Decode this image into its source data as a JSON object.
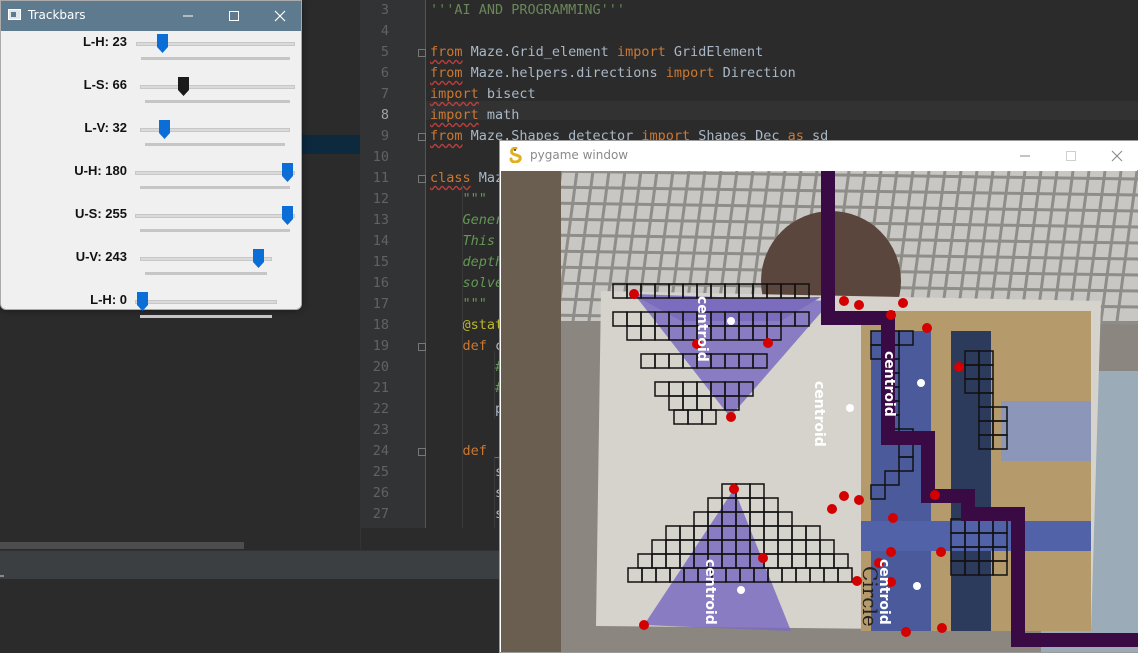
{
  "ide": {
    "lines": [
      {
        "num": "3",
        "segs": [
          {
            "t": "'''AI AND PROGRAMMING'''",
            "c": "str"
          }
        ]
      },
      {
        "num": "4",
        "segs": []
      },
      {
        "num": "5",
        "segs": [
          {
            "t": "from",
            "c": "kw squig"
          },
          {
            "t": " Maze.Grid_element ",
            "c": ""
          },
          {
            "t": "import",
            "c": "kw"
          },
          {
            "t": " GridElement",
            "c": ""
          }
        ]
      },
      {
        "num": "6",
        "segs": [
          {
            "t": "from",
            "c": "kw squig"
          },
          {
            "t": " Maze.helpers.directions ",
            "c": ""
          },
          {
            "t": "import",
            "c": "kw"
          },
          {
            "t": " Direction",
            "c": ""
          }
        ]
      },
      {
        "num": "7",
        "segs": [
          {
            "t": "import",
            "c": "kw squig"
          },
          {
            "t": " bisect",
            "c": ""
          }
        ]
      },
      {
        "num": "8",
        "segs": [
          {
            "t": "import",
            "c": "kw squig"
          },
          {
            "t": " math",
            "c": ""
          }
        ]
      },
      {
        "num": "9",
        "segs": [
          {
            "t": "from",
            "c": "kw squig"
          },
          {
            "t": " Maze.Shapes_detector ",
            "c": ""
          },
          {
            "t": "import",
            "c": "kw"
          },
          {
            "t": " Shapes_Dec ",
            "c": ""
          },
          {
            "t": "as",
            "c": "kw"
          },
          {
            "t": " sd",
            "c": ""
          }
        ]
      },
      {
        "num": "10",
        "segs": []
      },
      {
        "num": "11",
        "segs": [
          {
            "t": "class",
            "c": "kw squig"
          },
          {
            "t": " Maze",
            "c": ""
          }
        ]
      },
      {
        "num": "12",
        "segs": [
          {
            "t": "    \"\"\"",
            "c": "doc"
          }
        ]
      },
      {
        "num": "13",
        "segs": [
          {
            "t": "    Gener",
            "c": "doc"
          }
        ]
      },
      {
        "num": "14",
        "segs": [
          {
            "t": "    This",
            "c": "doc"
          }
        ]
      },
      {
        "num": "15",
        "segs": [
          {
            "t": "    depth",
            "c": "doc"
          }
        ]
      },
      {
        "num": "16",
        "segs": [
          {
            "t": "    solve",
            "c": "doc"
          }
        ]
      },
      {
        "num": "17",
        "segs": [
          {
            "t": "    \"\"\"",
            "c": "doc"
          }
        ]
      },
      {
        "num": "18",
        "segs": [
          {
            "t": "    @stat",
            "c": "deco"
          }
        ]
      },
      {
        "num": "19",
        "segs": [
          {
            "t": "    ",
            "c": ""
          },
          {
            "t": "def",
            "c": "kw"
          },
          {
            "t": " c",
            "c": ""
          }
        ]
      },
      {
        "num": "20",
        "segs": [
          {
            "t": "        #",
            "c": "doc"
          }
        ]
      },
      {
        "num": "21",
        "segs": [
          {
            "t": "        #",
            "c": "doc"
          }
        ]
      },
      {
        "num": "22",
        "segs": [
          {
            "t": "        p",
            "c": ""
          }
        ]
      },
      {
        "num": "23",
        "segs": []
      },
      {
        "num": "24",
        "segs": [
          {
            "t": "    ",
            "c": ""
          },
          {
            "t": "def",
            "c": "kw"
          },
          {
            "t": " _",
            "c": ""
          }
        ]
      },
      {
        "num": "25",
        "segs": [
          {
            "t": "        s",
            "c": ""
          }
        ]
      },
      {
        "num": "26",
        "segs": [
          {
            "t": "        s",
            "c": ""
          }
        ]
      },
      {
        "num": "27",
        "segs": [
          {
            "t": "        s",
            "c": ""
          }
        ]
      }
    ],
    "active_line": "8"
  },
  "trackbars": {
    "title": "Trackbars",
    "sliders": [
      {
        "label": "L-H: 23",
        "value": 23,
        "max": 179,
        "color": "#0a6ed6"
      },
      {
        "label": "L-S: 66",
        "value": 66,
        "max": 255,
        "color": "#1b1b1b"
      },
      {
        "label": "L-V: 32",
        "value": 32,
        "max": 255,
        "color": "#0a6ed6"
      },
      {
        "label": "U-H: 180",
        "value": 180,
        "max": 180,
        "color": "#0a6ed6"
      },
      {
        "label": "U-S: 255",
        "value": 255,
        "max": 255,
        "color": "#0a6ed6"
      },
      {
        "label": "U-V: 243",
        "value": 243,
        "max": 255,
        "color": "#0a6ed6"
      },
      {
        "label": "L-H: 0",
        "value": 0,
        "max": 179,
        "color": "#0a6ed6"
      }
    ]
  },
  "pygame": {
    "title": "pygame window",
    "labels": [
      "centroid",
      "centroid",
      "centroid",
      "centroid",
      "centroid",
      "centroid",
      "Circle"
    ],
    "colors": {
      "maze_wall": "#3a0a45",
      "shape_fill": "#7b6cc0",
      "vertex": "#d40000",
      "centroid": "#ffffff"
    }
  }
}
